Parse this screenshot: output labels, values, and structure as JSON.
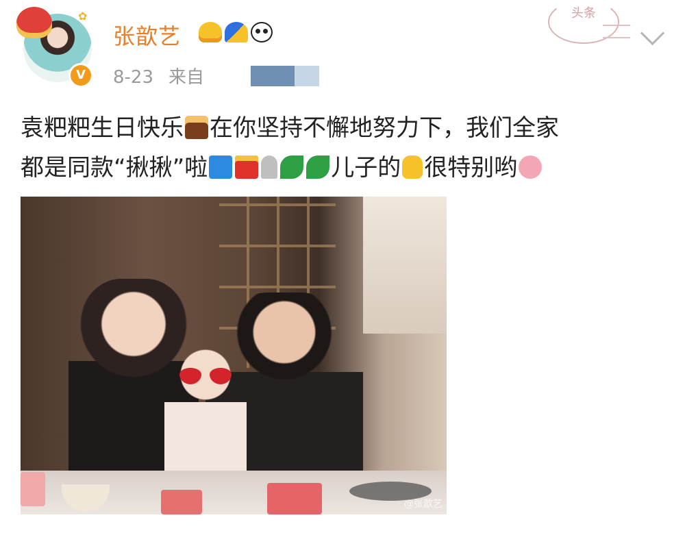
{
  "post": {
    "author": {
      "name": "张歆艺",
      "verified_badge": "V",
      "badges": [
        "crown-icon",
        "cap-icon",
        "panda-icon"
      ]
    },
    "date": "8-23",
    "source_label": "来自",
    "stamp_text": "头条",
    "content": {
      "line1": "袁粑粑生日快乐",
      "line1b": "在你坚持不懈地努力下，我们全家",
      "line2a": "都是同款“揪揪”啦",
      "line2b": "儿子的",
      "line2c": "很特别哟"
    },
    "photo": {
      "watermark": "@张歆艺"
    }
  },
  "colors": {
    "username": "#e8802a",
    "meta": "#9a9a9a",
    "text": "#222222",
    "verified": "#f29b1b"
  }
}
